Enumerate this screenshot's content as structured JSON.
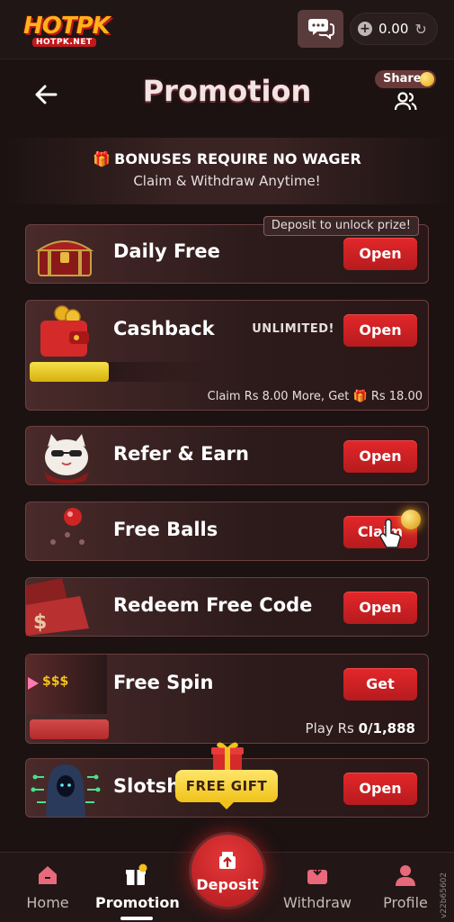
{
  "brand": {
    "logo_text": "HOTPK",
    "logo_sub": "HOTPK.NET"
  },
  "topbar": {
    "balance": "0.00"
  },
  "header": {
    "title": "Promotion",
    "share_label": "Share"
  },
  "banner": {
    "line1": "BONUSES REQUIRE NO WAGER",
    "line2": "Claim & Withdraw Anytime!"
  },
  "cards": {
    "daily_free": {
      "title": "Daily Free",
      "button": "Open",
      "tag": "Deposit to unlock prize!"
    },
    "cashback": {
      "title": "Cashback",
      "badge": "UNLIMITED!",
      "button": "Open",
      "claim_prefix": "Claim Rs 8.00 More, Get",
      "claim_suffix": "Rs 18.00",
      "progress_level": 0.2
    },
    "refer": {
      "title": "Refer & Earn",
      "button": "Open"
    },
    "free_balls": {
      "title": "Free Balls",
      "button": "Claim"
    },
    "redeem": {
      "title": "Redeem Free Code",
      "button": "Open"
    },
    "free_spin": {
      "title": "Free Spin",
      "button": "Get",
      "deco_text": "$$$",
      "play_prefix": "Play Rs",
      "play_value": "0/1,888"
    },
    "slotsh": {
      "title": "Slotsh",
      "button": "Open",
      "free_gift": "FREE GIFT"
    }
  },
  "nav": {
    "home": "Home",
    "promotion": "Promotion",
    "deposit": "Deposit",
    "withdraw": "Withdraw",
    "profile": "Profile"
  },
  "version": "v22b65602",
  "colors": {
    "accent_red": "#d4202a",
    "gold": "#f2c21a",
    "bg": "#1c1212"
  }
}
